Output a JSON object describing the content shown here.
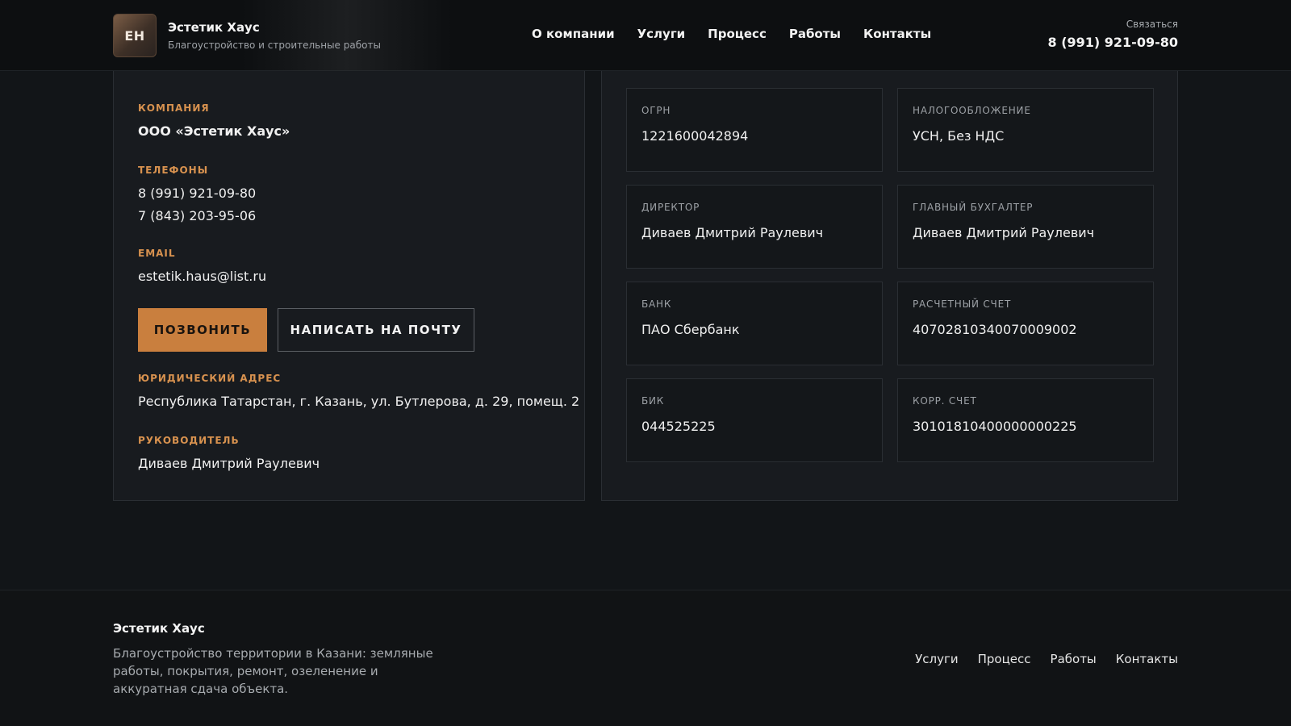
{
  "header": {
    "logo_text": "EH",
    "brand_name": "Эстетик Хаус",
    "tagline": "Благоустройство и строительные работы",
    "nav": [
      "О компании",
      "Услуги",
      "Процесс",
      "Работы",
      "Контакты"
    ],
    "contact_label": "Связаться",
    "contact_phone": "8 (991) 921-09-80"
  },
  "company_card": {
    "company": {
      "label": "Компания",
      "value": "ООО «Эстетик Хаус»"
    },
    "phones": {
      "label": "Телефоны",
      "values": [
        "8 (991) 921-09-80",
        "7 (843) 203-95-06"
      ]
    },
    "email": {
      "label": "Email",
      "value": "estetik.haus@list.ru"
    },
    "buttons": {
      "call": "Позвонить",
      "mail": "Написать на почту"
    },
    "address": {
      "label": "Юридический адрес",
      "value": "Республика Татарстан, г. Казань, ул. Бутлерова, д. 29, помещ. 2"
    },
    "head": {
      "label": "Руководитель",
      "value": "Диваев Дмитрий Раулевич"
    }
  },
  "requisites": [
    {
      "label": "ОГРН",
      "value": "1221600042894"
    },
    {
      "label": "Налогообложение",
      "value": "УСН, Без НДС"
    },
    {
      "label": "Директор",
      "value": "Диваев Дмитрий Раулевич"
    },
    {
      "label": "Главный бухгалтер",
      "value": "Диваев Дмитрий Раулевич"
    },
    {
      "label": "Банк",
      "value": "ПАО Сбербанк"
    },
    {
      "label": "Расчетный счет",
      "value": "40702810340070009002"
    },
    {
      "label": "БИК",
      "value": "044525225"
    },
    {
      "label": "Корр. счет",
      "value": "30101810400000000225"
    }
  ],
  "footer": {
    "brand": "Эстетик Хаус",
    "description": "Благоустройство территории в Казани: земляные работы, покрытия, ремонт, озеленение и аккуратная сдача объекта.",
    "nav": [
      "Услуги",
      "Процесс",
      "Работы",
      "Контакты"
    ]
  },
  "colors": {
    "background": "#121518",
    "accent": "#c97f3e",
    "label_accent": "#d8924f"
  }
}
